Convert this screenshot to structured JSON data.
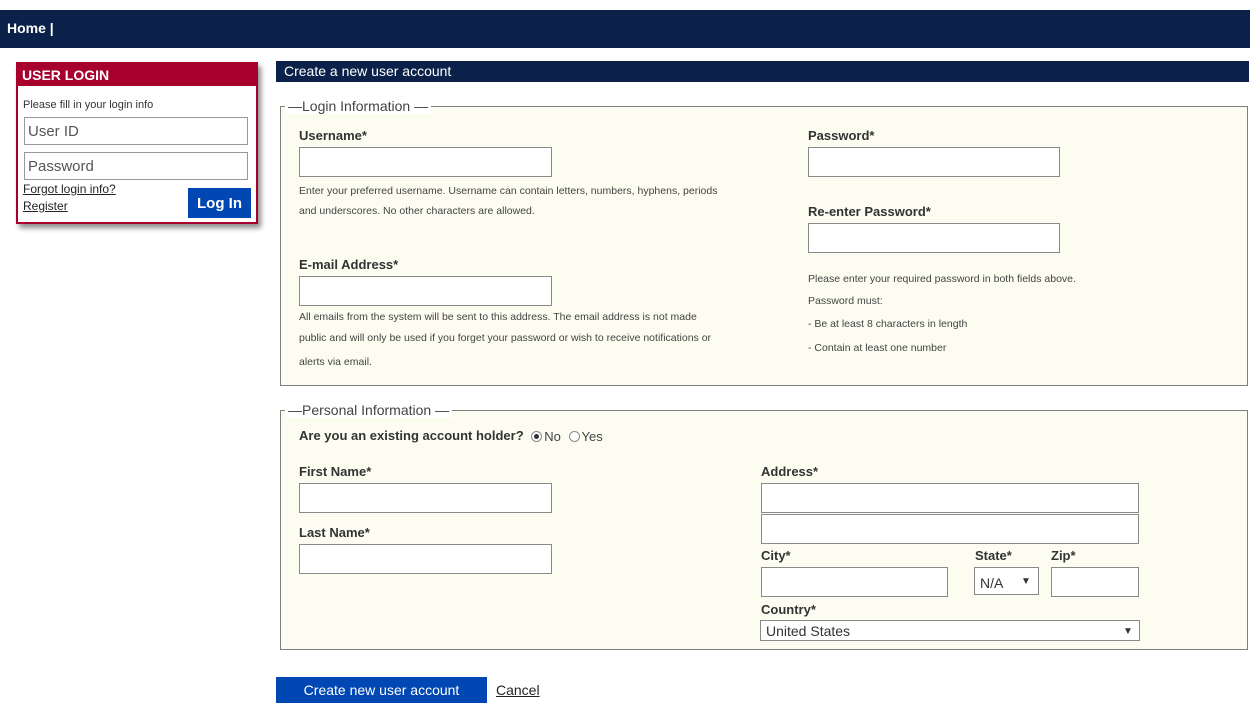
{
  "nav": {
    "home": "Home |"
  },
  "login": {
    "title": "USER LOGIN",
    "hint": "Please fill in your login info",
    "userid_placeholder": "User ID",
    "password_placeholder": "Password",
    "forgot": "Forgot login info?",
    "register": "Register",
    "login_button": "Log In"
  },
  "page": {
    "title": "Create a new user account"
  },
  "login_info": {
    "legend": "Login Information",
    "username_label": "Username*",
    "username_help_1": "Enter your preferred username. Username can contain letters, numbers, hyphens, periods",
    "username_help_2": "and underscores. No other characters are allowed.",
    "email_label": "E-mail Address*",
    "email_help_1": "All emails from the system will be sent to this address. The email address is not made",
    "email_help_2": "public and will only be used if you forget your password or wish to receive notifications or",
    "email_help_3": "alerts via email.",
    "password_label": "Password*",
    "reenter_label": "Re-enter Password*",
    "pw_help_1": "Please enter your required password in both fields above.",
    "pw_help_2": "Password must:",
    "pw_help_3": "- Be at least 8 characters in length",
    "pw_help_4": "- Contain at least one number"
  },
  "personal_info": {
    "legend": "Personal Information",
    "existing_question": "Are you an existing account holder?",
    "existing_options": [
      "No",
      "Yes"
    ],
    "existing_selected": "No",
    "first_name_label": "First Name*",
    "last_name_label": "Last Name*",
    "address_label": "Address*",
    "city_label": "City*",
    "state_label": "State*",
    "state_value": "N/A",
    "zip_label": "Zip*",
    "country_label": "Country*",
    "country_value": "United States"
  },
  "actions": {
    "create": "Create new user account",
    "cancel": "Cancel"
  },
  "icons": {
    "dropdown": "chevron-down-icon"
  },
  "colors": {
    "navy": "#0c2149",
    "login_red": "#a8002c",
    "button_blue": "#0047b3",
    "fieldset_bg": "#fcfcf0"
  }
}
